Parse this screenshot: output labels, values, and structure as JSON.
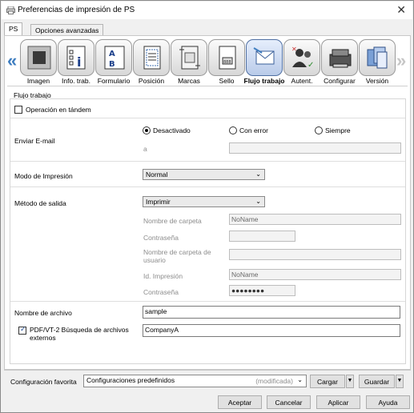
{
  "window": {
    "title": "Preferencias de impresión de PS"
  },
  "tabs": [
    {
      "label": "PS"
    },
    {
      "label": "Opciones avanzadas"
    }
  ],
  "toolbar": [
    {
      "label": "Imagen",
      "icon": "image-icon"
    },
    {
      "label": "Info. trab.",
      "icon": "job-info-icon"
    },
    {
      "label": "Formulario",
      "icon": "form-icon"
    },
    {
      "label": "Posición",
      "icon": "position-icon"
    },
    {
      "label": "Marcas",
      "icon": "marks-icon"
    },
    {
      "label": "Sello",
      "icon": "stamp-icon"
    },
    {
      "label": "Flujo trabajo",
      "icon": "workflow-icon",
      "selected": true
    },
    {
      "label": "Autent.",
      "icon": "authentication-icon"
    },
    {
      "label": "Configurar",
      "icon": "configure-icon"
    },
    {
      "label": "Versión",
      "icon": "version-icon"
    }
  ],
  "section": {
    "title": "Flujo trabajo"
  },
  "tandem": {
    "label": "Operación en tándem",
    "checked": false
  },
  "email": {
    "label": "Enviar E-mail",
    "options": [
      "Desactivado",
      "Con error",
      "Siempre"
    ],
    "selected": "Desactivado",
    "to_label": "a",
    "to_value": ""
  },
  "print_mode": {
    "label": "Modo de Impresión",
    "value": "Normal"
  },
  "output": {
    "label": "Método de salida",
    "value": "Imprimir",
    "folder_name_label": "Nombre de carpeta",
    "folder_name_value": "NoName",
    "password_label": "Contraseña",
    "user_folder_label": "Nombre de carpeta de usuario",
    "print_id_label": "Id. Impresión",
    "print_id_value": "NoName",
    "print_password_label": "Contraseña",
    "print_password_value": "●●●●●●●●"
  },
  "filename": {
    "label": "Nombre de archivo",
    "value": "sample"
  },
  "pdf_search": {
    "label": "PDF/VT-2 Búsqueda de archivos externos",
    "checked": true,
    "value": "CompanyA"
  },
  "favorites": {
    "label": "Configuración favorita",
    "value": "Configuraciones predefinidos",
    "modified": "(modificada)",
    "load_label": "Cargar",
    "save_label": "Guardar"
  },
  "buttons": {
    "ok": "Aceptar",
    "cancel": "Cancelar",
    "apply": "Aplicar",
    "help": "Ayuda"
  },
  "colors": {
    "accent": "#3f7ec0",
    "selected_tool": "#b9cbe9"
  }
}
